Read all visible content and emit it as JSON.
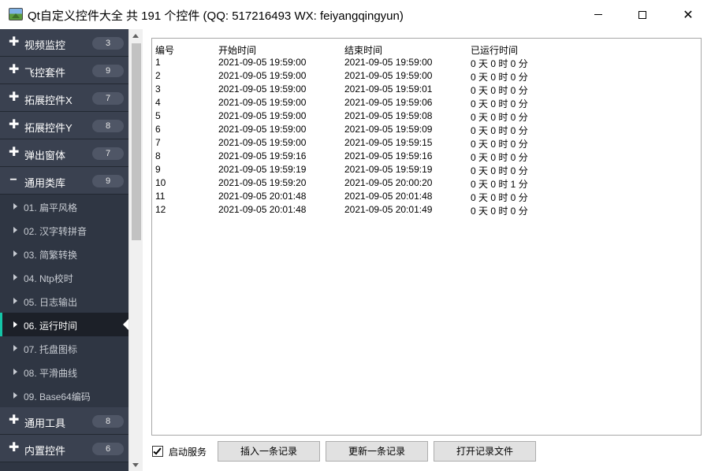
{
  "window": {
    "title": "Qt自定义控件大全 共 191 个控件 (QQ: 517216493 WX: feiyangqingyun)",
    "min_glyph": "",
    "max_glyph": "",
    "close_glyph": "✕"
  },
  "nav": {
    "groups_top": [
      {
        "sign": "✚",
        "label": "视频监控",
        "count": "3"
      },
      {
        "sign": "✚",
        "label": "飞控套件",
        "count": "9"
      },
      {
        "sign": "✚",
        "label": "拓展控件X",
        "count": "7"
      },
      {
        "sign": "✚",
        "label": "拓展控件Y",
        "count": "8"
      },
      {
        "sign": "✚",
        "label": "弹出窗体",
        "count": "7"
      },
      {
        "sign": "−",
        "label": "通用类库",
        "count": "9"
      }
    ],
    "items": [
      {
        "label": "01. 扁平风格"
      },
      {
        "label": "02. 汉字转拼音"
      },
      {
        "label": "03. 简繁转换"
      },
      {
        "label": "04. Ntp校时"
      },
      {
        "label": "05. 日志输出"
      },
      {
        "label": "06. 运行时间"
      },
      {
        "label": "07. 托盘图标"
      },
      {
        "label": "08. 平滑曲线"
      },
      {
        "label": "09. Base64编码"
      }
    ],
    "active_index": 5,
    "groups_bottom": [
      {
        "sign": "✚",
        "label": "通用工具",
        "count": "8"
      },
      {
        "sign": "✚",
        "label": "内置控件",
        "count": "6"
      }
    ],
    "accent_color": "#14c5a7"
  },
  "table": {
    "headers": [
      "编号",
      "开始时间",
      "结束时间",
      "已运行时间"
    ],
    "rows": [
      [
        "1",
        "2021-09-05 19:59:00",
        "2021-09-05 19:59:00",
        "0 天 0 时 0 分"
      ],
      [
        "2",
        "2021-09-05 19:59:00",
        "2021-09-05 19:59:00",
        "0 天 0 时 0 分"
      ],
      [
        "3",
        "2021-09-05 19:59:00",
        "2021-09-05 19:59:01",
        "0 天 0 时 0 分"
      ],
      [
        "4",
        "2021-09-05 19:59:00",
        "2021-09-05 19:59:06",
        "0 天 0 时 0 分"
      ],
      [
        "5",
        "2021-09-05 19:59:00",
        "2021-09-05 19:59:08",
        "0 天 0 时 0 分"
      ],
      [
        "6",
        "2021-09-05 19:59:00",
        "2021-09-05 19:59:09",
        "0 天 0 时 0 分"
      ],
      [
        "7",
        "2021-09-05 19:59:00",
        "2021-09-05 19:59:15",
        "0 天 0 时 0 分"
      ],
      [
        "8",
        "2021-09-05 19:59:16",
        "2021-09-05 19:59:16",
        "0 天 0 时 0 分"
      ],
      [
        "9",
        "2021-09-05 19:59:19",
        "2021-09-05 19:59:19",
        "0 天 0 时 0 分"
      ],
      [
        "10",
        "2021-09-05 19:59:20",
        "2021-09-05 20:00:20",
        "0 天 0 时 1 分"
      ],
      [
        "11",
        "2021-09-05 20:01:48",
        "2021-09-05 20:01:48",
        "0 天 0 时 0 分"
      ],
      [
        "12",
        "2021-09-05 20:01:48",
        "2021-09-05 20:01:49",
        "0 天 0 时 0 分"
      ]
    ]
  },
  "controls": {
    "start_service_label": "启动服务",
    "start_service_checked": true,
    "insert_label": "插入一条记录",
    "update_label": "更新一条记录",
    "open_file_label": "打开记录文件"
  }
}
